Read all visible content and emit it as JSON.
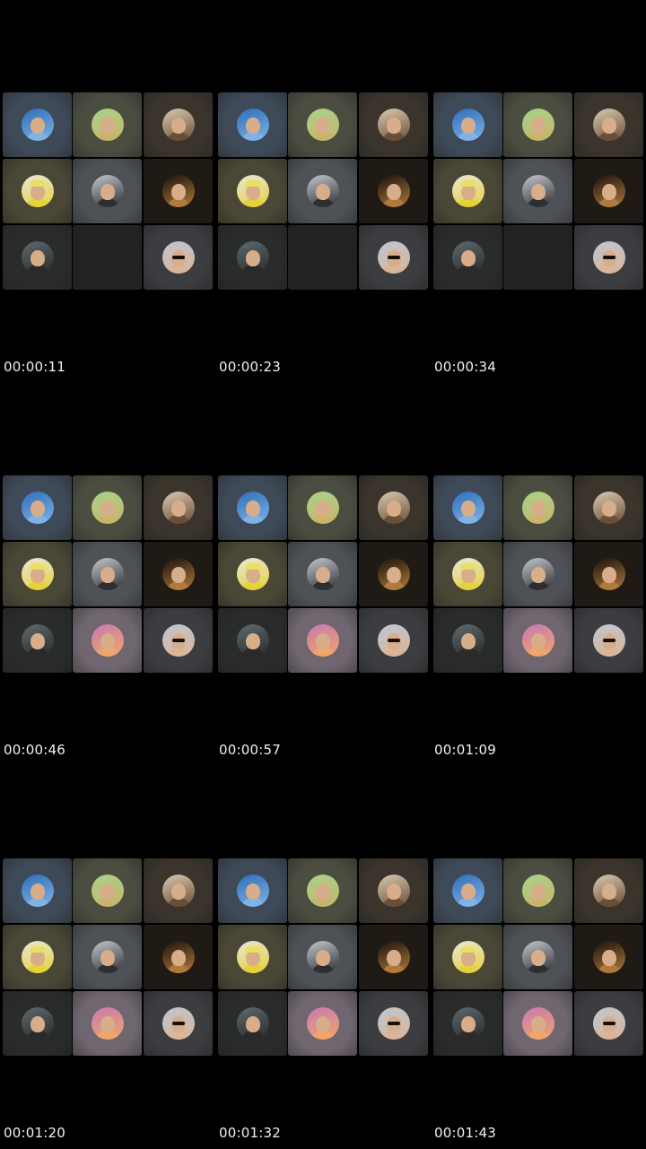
{
  "frames": [
    {
      "timestamp": "00:00:11",
      "ninth_tile_present": false
    },
    {
      "timestamp": "00:00:23",
      "ninth_tile_present": false
    },
    {
      "timestamp": "00:00:34",
      "ninth_tile_present": false
    },
    {
      "timestamp": "00:00:46",
      "ninth_tile_present": true
    },
    {
      "timestamp": "00:00:57",
      "ninth_tile_present": true
    },
    {
      "timestamp": "00:01:09",
      "ninth_tile_present": true
    },
    {
      "timestamp": "00:01:20",
      "ninth_tile_present": true
    },
    {
      "timestamp": "00:01:32",
      "ninth_tile_present": true
    },
    {
      "timestamp": "00:01:43",
      "ninth_tile_present": true
    }
  ],
  "participants": [
    {
      "icon": "avatar-ocean-photo-icon",
      "tile_color": "#3f4a58",
      "avatar_bg": "#2f6fb8",
      "accent": "#7fb3e6"
    },
    {
      "icon": "avatar-green-selfie-icon",
      "tile_color": "#4a4d40",
      "avatar_bg": "#a8d28a",
      "accent": "#c7b56a"
    },
    {
      "icon": "avatar-bearded-man-icon",
      "tile_color": "#3a342c",
      "avatar_bg": "#d9c9b2",
      "accent": "#6b4e36"
    },
    {
      "icon": "avatar-yellow-jacket-icon",
      "tile_color": "#4a4736",
      "avatar_bg": "#e8e6dc",
      "accent": "#e5d23a"
    },
    {
      "icon": "avatar-car-photo-icon",
      "tile_color": "#4e5156",
      "avatar_bg": "#c4c8cc",
      "accent": "#2c2e32"
    },
    {
      "icon": "avatar-dark-portrait-icon",
      "tile_color": "#1f1a14",
      "avatar_bg": "#1a120c",
      "accent": "#b07a3c"
    },
    {
      "icon": "avatar-city-night-icon",
      "tile_color": "#2a2c2c",
      "avatar_bg": "#5e6a6e",
      "accent": "#2a2a2a"
    },
    {
      "icon": "avatar-sunset-photo-icon",
      "tile_color": "#6f6670",
      "avatar_bg": "#c77ab0",
      "accent": "#f0a56a"
    },
    {
      "icon": "avatar-sunglasses-man-icon",
      "tile_color": "#3c3d40",
      "avatar_bg": "#bfc6cf",
      "accent": "#d9b59a"
    }
  ],
  "empty_tile_color": "#202321"
}
